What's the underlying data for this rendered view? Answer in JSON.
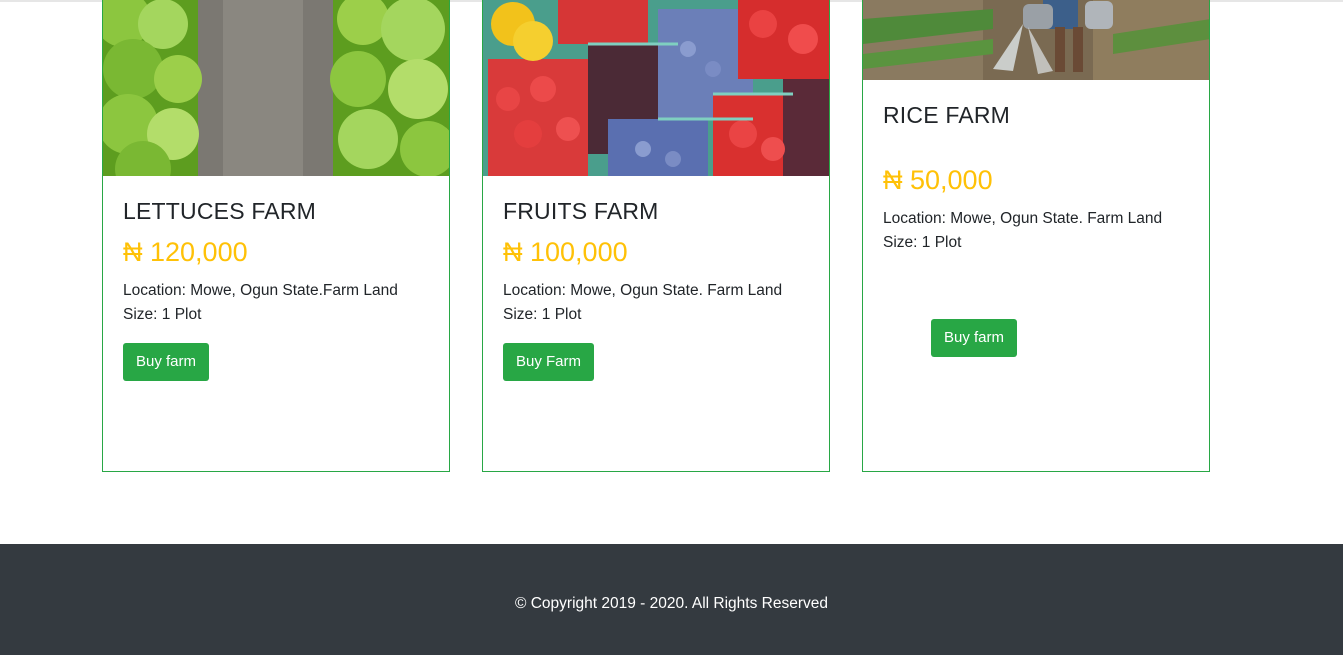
{
  "cards": [
    {
      "title": "LETTUCES FARM",
      "price": "₦ 120,000",
      "location": "Location: Mowe, Ogun State.Farm Land",
      "size": "Size: 1 Plot",
      "button": "Buy farm",
      "image": "lettuce-rows-image"
    },
    {
      "title": "FRUITS FARM",
      "price": "₦ 100,000",
      "location": "Location: Mowe, Ogun State. Farm Land",
      "size": "Size: 1 Plot",
      "button": "Buy Farm",
      "image": "berry-baskets-image"
    },
    {
      "title": "RICE FARM",
      "price": "₦ 50,000",
      "location": "Location: Mowe, Ogun State. Farm Land",
      "size": "Size: 1 Plot",
      "button": "Buy farm",
      "image": "watering-field-image"
    }
  ],
  "footer": {
    "copyright": "© Copyright 2019 - 2020. All Rights Reserved"
  },
  "colors": {
    "card_border": "#28a745",
    "button_bg": "#28a745",
    "price": "#ffc107",
    "footer_bg": "#343a40"
  }
}
